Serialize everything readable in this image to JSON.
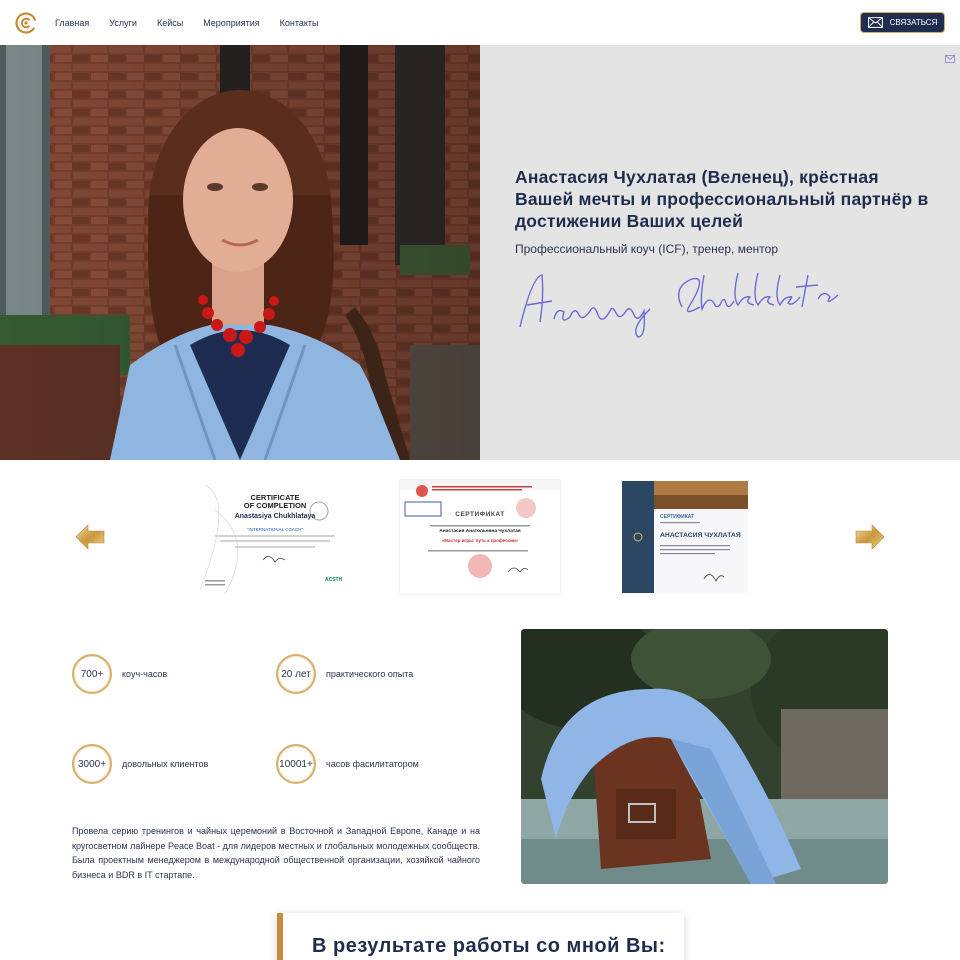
{
  "nav": {
    "items": [
      "Главная",
      "Услуги",
      "Кейсы",
      "Мероприятия",
      "Контакты"
    ],
    "contact_label": "СВЯЗАТЬСЯ"
  },
  "hero": {
    "title": "Анастасия Чухлатая (Веленец), крёстная Вашей мечты и профессиональный партнёр в достижении Ваших целей",
    "subtitle": "Профессиональный коуч (ICF), тренер, ментор",
    "signature": "Anastasiya Chukhlataya"
  },
  "certificates": [
    {
      "heading1": "CERTIFICATE",
      "heading2": "OF COMPLETION",
      "name": "Anastasiya Chukhlataya",
      "program": "\"INTERNATIONAL COACH\"",
      "badge": "ACSTH"
    },
    {
      "heading": "СЕРТИФИКАТ",
      "name": "Анастасия Анатольевна Чухлатая",
      "program": "«Мастер игры: путь к профессии»"
    },
    {
      "heading": "СЕРТИФИКАТ",
      "name": "АНАСТАСИЯ ЧУХЛАТАЯ"
    }
  ],
  "stats": [
    {
      "value": "700+",
      "label": "коуч-часов"
    },
    {
      "value": "20 лет",
      "label": "практического опыта"
    },
    {
      "value": "3000+",
      "label": "довольных клиентов"
    },
    {
      "value": "10001+",
      "label": "часов фасилитатором"
    }
  ],
  "about": "Провела серию тренингов и чайных церемоний в Восточной и Западной Европе, Канаде и на кругосветном лайнере Peace Boat - для лидеров местных и глобальных молодежных сообществ. Была проектным менеджером в международной общественной организации, хозяйкой чайного бизнеса и BDR в IT стартапе.",
  "result": {
    "title": "В результате работы со мной Вы:"
  },
  "colors": {
    "navy": "#1f2d4d",
    "gold": "#d8b06c",
    "accent_bar": "#c78b3c",
    "hero_panel": "#e4e4e4"
  },
  "icons": [
    "logo-icon",
    "mail-icon",
    "arrow-left-icon",
    "arrow-right-icon"
  ]
}
